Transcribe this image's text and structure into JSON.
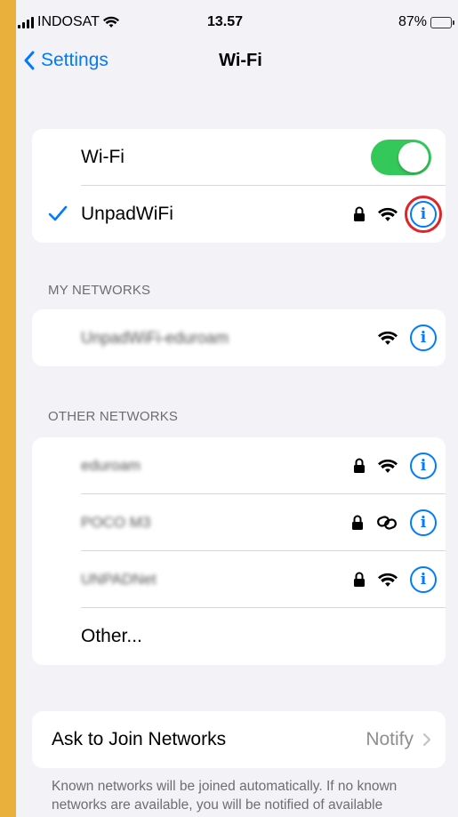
{
  "status_bar": {
    "carrier": "INDOSAT",
    "time": "13.57",
    "battery_percent": "87%"
  },
  "nav": {
    "back_label": "Settings",
    "title": "Wi-Fi"
  },
  "wifi": {
    "toggle_label": "Wi-Fi",
    "toggle_on": true,
    "connected_network": "UnpadWiFi"
  },
  "my_networks": {
    "header": "MY NETWORKS",
    "items": [
      {
        "name": "UnpadWiFi-eduroam"
      }
    ]
  },
  "other_networks": {
    "header": "OTHER NETWORKS",
    "items": [
      {
        "name": "eduroam"
      },
      {
        "name": "POCO M3"
      },
      {
        "name": "UNPADNet"
      }
    ],
    "other_label": "Other..."
  },
  "ask_to_join": {
    "label": "Ask to Join Networks",
    "value": "Notify"
  },
  "footnote": "Known networks will be joined automatically. If no known networks are available, you will be notified of available networks.",
  "colors": {
    "accent": "#007aff",
    "toggle_on": "#34c759",
    "highlight": "#e0242a",
    "background": "#e9b13c"
  }
}
